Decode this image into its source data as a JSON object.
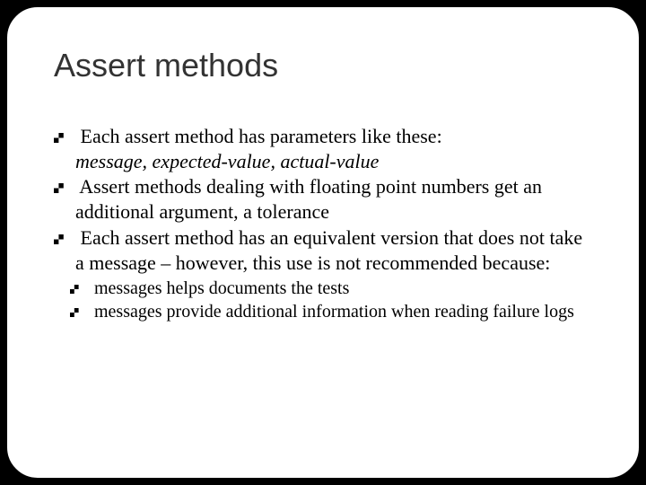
{
  "slide": {
    "title": "Assert methods",
    "bullets": [
      {
        "text": "Each assert method has parameters like these:",
        "cont_italic": "message, expected-value, actual-value"
      },
      {
        "text": "Assert methods dealing with floating point numbers get an additional argument, a tolerance"
      },
      {
        "text": "Each assert method has an equivalent version that does not take a message – however, this use is not recommended because:",
        "sub": [
          {
            "text": "messages helps documents the tests"
          },
          {
            "text": "messages provide additional information when reading failure logs"
          }
        ]
      }
    ]
  }
}
